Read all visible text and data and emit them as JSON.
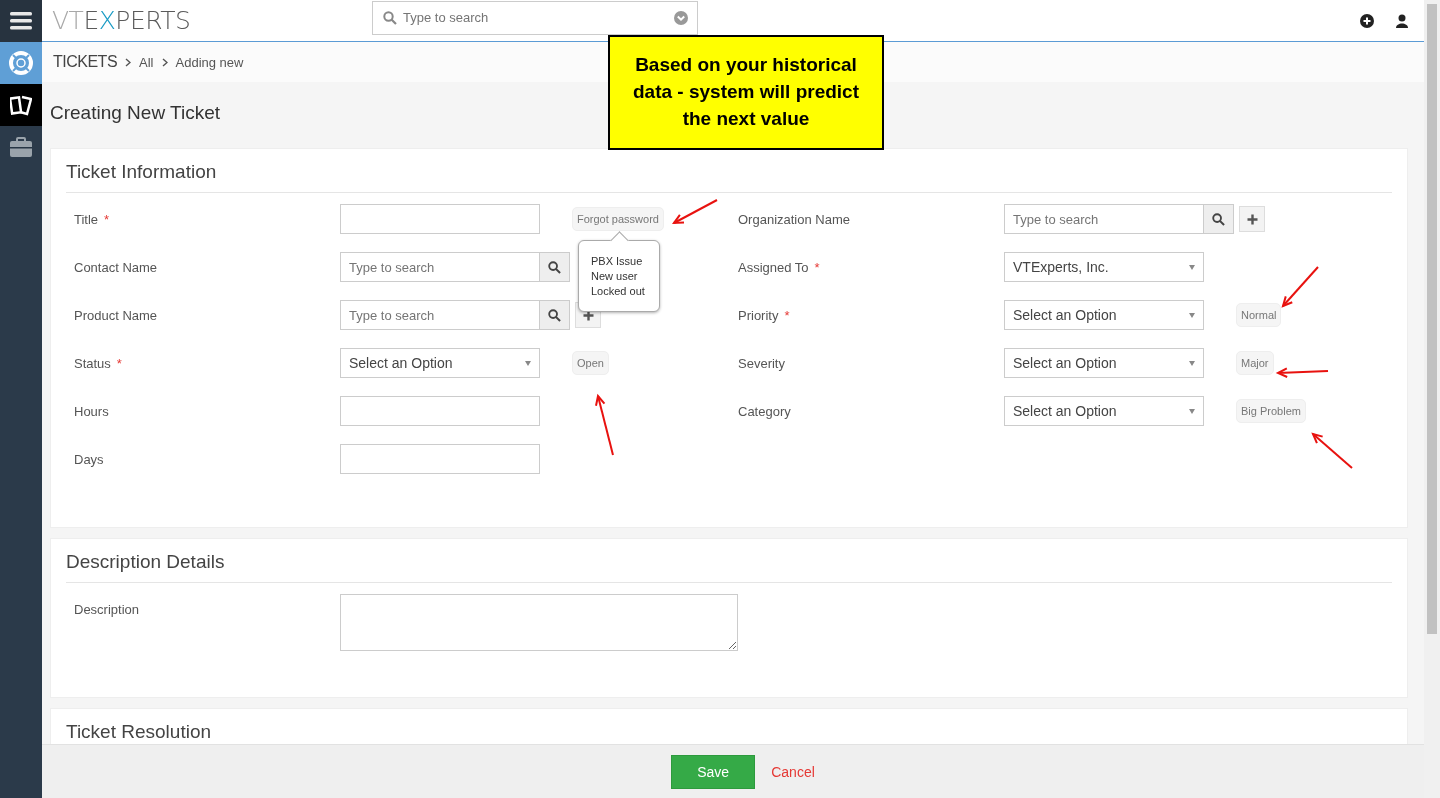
{
  "sidebar": {
    "items": [
      {
        "kind": "lifebuoy",
        "color": "#5f9fd6",
        "selected": false
      },
      {
        "kind": "tickets",
        "selected": true
      },
      {
        "kind": "briefcase",
        "selected": false
      }
    ]
  },
  "topbar": {
    "logo": [
      {
        "text": "VT",
        "color": "#a8a8a8"
      },
      {
        "text": "E",
        "color": "#5a5a5a"
      },
      {
        "text": "X",
        "color": "#1a9bc4"
      },
      {
        "text": "PERTS",
        "color": "#5a5a5a"
      }
    ],
    "search": {
      "placeholder": "Type to search"
    }
  },
  "breadcrumb": [
    "TICKETS",
    "All",
    "Adding new"
  ],
  "page_title": "Creating New Ticket",
  "callout": "Based on your historical data - system will predict the next value",
  "sections": [
    {
      "title": "Ticket Information",
      "columns": [
        [
          {
            "label": "Title",
            "required": true,
            "kind": "text",
            "suggestion": {
              "label": "Forgot password",
              "options": [
                "PBX Issue",
                "New user",
                "Locked out"
              ]
            }
          },
          {
            "label": "Contact Name",
            "required": false,
            "kind": "lookup",
            "placeholder": "Type to search",
            "add_button": false
          },
          {
            "label": "Product Name",
            "required": false,
            "kind": "lookup",
            "placeholder": "Type to search",
            "add_button": true
          },
          {
            "label": "Status",
            "required": true,
            "kind": "select",
            "value": "Select an Option",
            "suggestion": {
              "label": "Open"
            }
          },
          {
            "label": "Hours",
            "required": false,
            "kind": "text"
          },
          {
            "label": "Days",
            "required": false,
            "kind": "text"
          }
        ],
        [
          {
            "label": "Organization Name",
            "required": false,
            "kind": "lookup",
            "placeholder": "Type to search",
            "add_button": true
          },
          {
            "label": "Assigned To",
            "required": true,
            "kind": "select",
            "value": "VTExperts, Inc."
          },
          {
            "label": "Priority",
            "required": true,
            "kind": "select",
            "value": "Select an Option",
            "suggestion": {
              "label": "Normal"
            }
          },
          {
            "label": "Severity",
            "required": false,
            "kind": "select",
            "value": "Select an Option",
            "suggestion": {
              "label": "Major"
            }
          },
          {
            "label": "Category",
            "required": false,
            "kind": "select",
            "value": "Select an Option",
            "suggestion": {
              "label": "Big Problem"
            }
          }
        ]
      ]
    },
    {
      "title": "Description Details",
      "columns": [
        [
          {
            "label": "Description",
            "required": false,
            "kind": "textarea"
          }
        ]
      ]
    },
    {
      "title": "Ticket Resolution"
    }
  ],
  "required_mark": "*",
  "footer": {
    "save": "Save",
    "cancel": "Cancel"
  }
}
